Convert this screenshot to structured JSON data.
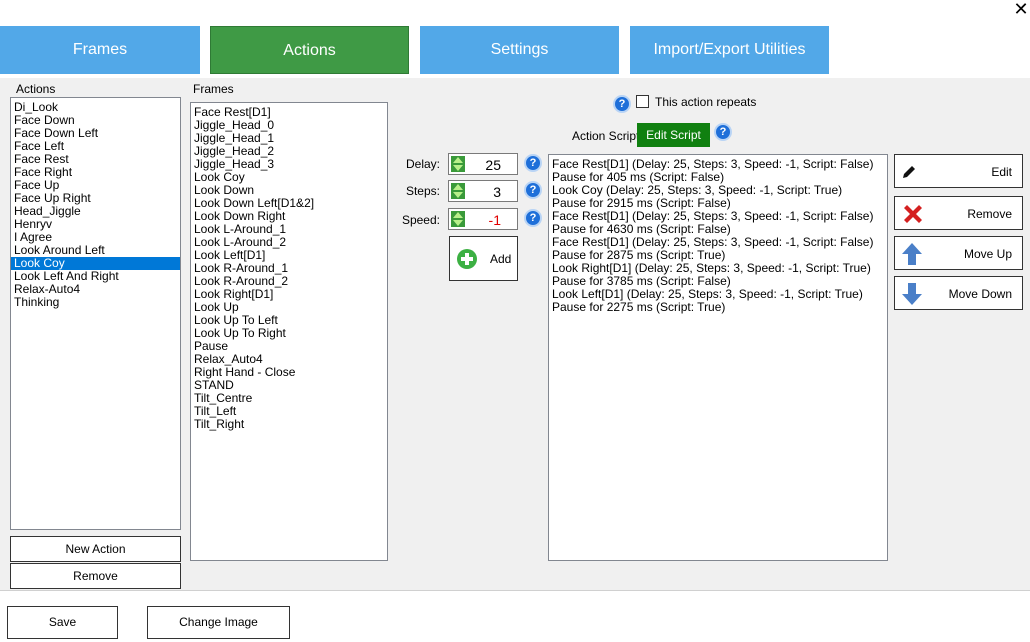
{
  "tabs": {
    "frames": "Frames",
    "actions": "Actions",
    "settings": "Settings",
    "import_export": "Import/Export Utilities"
  },
  "actions_panel": {
    "label": "Actions",
    "items": [
      "Di_Look",
      "Face Down",
      "Face Down Left",
      "Face Left",
      "Face Rest",
      "Face Right",
      "Face Up",
      "Face Up Right",
      "Head_Jiggle",
      "Henryv",
      "I Agree",
      "Look Around Left",
      "Look Coy",
      "Look Left And Right",
      "Relax-Auto4",
      "Thinking"
    ],
    "selected": "Look Coy",
    "new_action": "New Action",
    "remove": "Remove"
  },
  "frames_panel": {
    "label": "Frames",
    "items": [
      "Face Rest[D1]",
      "Jiggle_Head_0",
      "Jiggle_Head_1",
      "Jiggle_Head_2",
      "Jiggle_Head_3",
      "Look Coy",
      "Look Down",
      "Look Down Left[D1&2]",
      "Look Down Right",
      "Look L-Around_1",
      "Look L-Around_2",
      "Look Left[D1]",
      "Look R-Around_1",
      "Look R-Around_2",
      "Look Right[D1]",
      "Look Up",
      "Look Up To Left",
      "Look Up To Right",
      "Pause",
      "Relax_Auto4",
      "Right Hand - Close",
      "STAND",
      "Tilt_Centre",
      "Tilt_Left",
      "Tilt_Right"
    ]
  },
  "controls": {
    "repeat_label": "This action repeats",
    "action_script_label": "Action Script:",
    "edit_script": "Edit Script",
    "delay_label": "Delay:",
    "delay_value": "25",
    "steps_label": "Steps:",
    "steps_value": "3",
    "speed_label": "Speed:",
    "speed_value": "-1",
    "add_label": "Add"
  },
  "sequence": {
    "items": [
      "Face Rest[D1] (Delay: 25, Steps: 3, Speed: -1, Script: False)",
      "Pause for 405 ms (Script: False)",
      "Look Coy (Delay: 25, Steps: 3, Speed: -1, Script: True)",
      "Pause for 2915 ms (Script: False)",
      "Face Rest[D1] (Delay: 25, Steps: 3, Speed: -1, Script: False)",
      "Pause for 4630 ms (Script: False)",
      "Face Rest[D1] (Delay: 25, Steps: 3, Speed: -1, Script: False)",
      "Pause for 2875 ms (Script: True)",
      "Look Right[D1] (Delay: 25, Steps: 3, Speed: -1, Script: True)",
      "Pause for 3785 ms (Script: False)",
      "Look Left[D1] (Delay: 25, Steps: 3, Speed: -1, Script: True)",
      "Pause for 2275 ms (Script: True)"
    ]
  },
  "side_buttons": {
    "edit": "Edit",
    "remove": "Remove",
    "move_up": "Move Up",
    "move_down": "Move Down"
  },
  "footer": {
    "save": "Save",
    "change_image": "Change Image"
  },
  "window": {
    "close": "✕"
  },
  "colors": {
    "tab_blue": "#52a8e8",
    "tab_active_green": "#3f9a45",
    "edit_script_green": "#108010",
    "selection": "#0078d7",
    "speed_value": "#e00000"
  }
}
